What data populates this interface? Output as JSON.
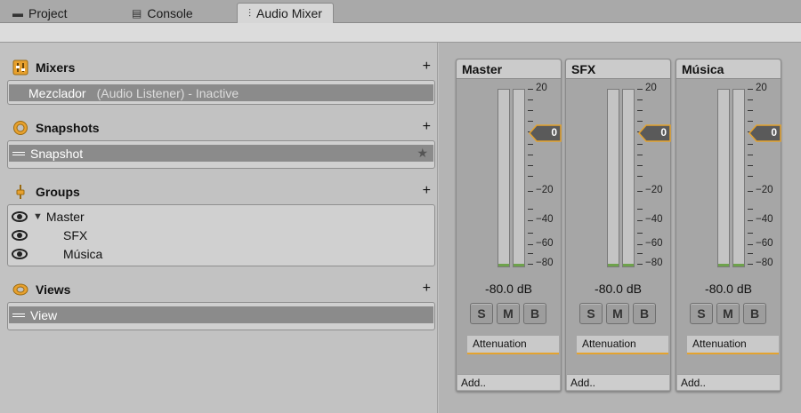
{
  "tabs": [
    {
      "label": "Project",
      "icon": "folder-icon"
    },
    {
      "label": "Console",
      "icon": "console-icon"
    },
    {
      "label": "Audio Mixer",
      "icon": "mixer-icon",
      "active": true
    }
  ],
  "sections": {
    "mixers": {
      "title": "Mixers",
      "add": "+",
      "items": [
        {
          "name": "Mezclador",
          "detail": "(Audio Listener) - Inactive"
        }
      ]
    },
    "snapshots": {
      "title": "Snapshots",
      "add": "+",
      "items": [
        {
          "name": "Snapshot",
          "star": "★"
        }
      ]
    },
    "groups": {
      "title": "Groups",
      "add": "+",
      "items": [
        {
          "name": "Master",
          "expander": "▼"
        },
        {
          "name": "SFX"
        },
        {
          "name": "Música"
        }
      ]
    },
    "views": {
      "title": "Views",
      "add": "+",
      "items": [
        {
          "name": "View"
        }
      ]
    }
  },
  "strips": [
    {
      "name": "Master",
      "fader_value": "0",
      "level": "-80.0 dB",
      "solo": "S",
      "mute": "M",
      "bypass": "B",
      "effect": "Attenuation",
      "add": "Add.."
    },
    {
      "name": "SFX",
      "fader_value": "0",
      "level": "-80.0 dB",
      "solo": "S",
      "mute": "M",
      "bypass": "B",
      "effect": "Attenuation",
      "add": "Add.."
    },
    {
      "name": "Música",
      "fader_value": "0",
      "level": "-80.0 dB",
      "solo": "S",
      "mute": "M",
      "bypass": "B",
      "effect": "Attenuation",
      "add": "Add.."
    }
  ],
  "scale_labels": {
    "top": "20",
    "m20": "−20",
    "m40": "−40",
    "m60": "−60",
    "m80": "−80"
  },
  "colors": {
    "accent": "#e4a32f",
    "meter_green": "#6ea24c",
    "selection": "#8b8b8b"
  }
}
